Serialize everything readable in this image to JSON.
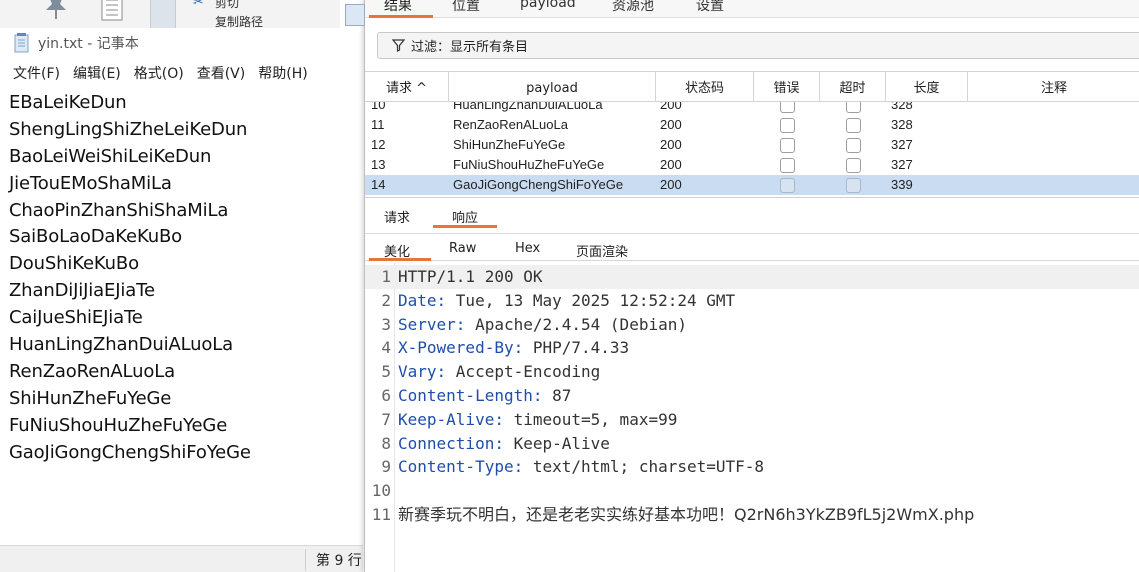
{
  "explorer": {
    "ribbon": [
      "剪切",
      "复制路径"
    ]
  },
  "notepad": {
    "title": "yin.txt - 记事本",
    "menu": [
      "文件(F)",
      "编辑(E)",
      "格式(O)",
      "查看(V)",
      "帮助(H)"
    ],
    "lines": [
      "EBaLeiKeDun",
      "ShengLingShiZheLeiKeDun",
      "BaoLeiWeiShiLeiKeDun",
      "JieTouEMoShaMiLa",
      "ChaoPinZhanShiShaMiLa",
      "SaiBoLaoDaKeKuBo",
      "DouShiKeKuBo",
      "ZhanDiJiJiaEJiaTe",
      "CaiJueShiEJiaTe",
      "HuanLingZhanDuiALuoLa",
      "RenZaoRenALuoLa",
      "ShiHunZheFuYeGe",
      "FuNiuShouHuZheFuYeGe",
      "GaoJiGongChengShiFoYeGe"
    ],
    "status": {
      "position": "第 9 行"
    },
    "edge_marks": [
      "权",
      "e"
    ]
  },
  "burp": {
    "top_tabs": [
      "结果",
      "位置",
      "payload",
      "资源池",
      "设置"
    ],
    "filter": {
      "text": "过滤：显示所有条目"
    },
    "columns": [
      "请求 ^",
      "payload",
      "状态码",
      "错误",
      "超时",
      "长度",
      "注释"
    ],
    "rows": [
      {
        "req": "10",
        "payload": "HuanLingZhanDuiALuoLa",
        "status": "200",
        "length": "328",
        "selected": false
      },
      {
        "req": "11",
        "payload": "RenZaoRenALuoLa",
        "status": "200",
        "length": "328",
        "selected": false
      },
      {
        "req": "12",
        "payload": "ShiHunZheFuYeGe",
        "status": "200",
        "length": "327",
        "selected": false
      },
      {
        "req": "13",
        "payload": "FuNiuShouHuZheFuYeGe",
        "status": "200",
        "length": "327",
        "selected": false
      },
      {
        "req": "14",
        "payload": "GaoJiGongChengShiFoYeGe",
        "status": "200",
        "length": "339",
        "selected": true
      }
    ],
    "req_resp_tabs": [
      "请求",
      "响应"
    ],
    "view_tabs": [
      "美化",
      "Raw",
      "Hex",
      "页面渲染"
    ],
    "response": {
      "status_line": "HTTP/1.1 200 OK",
      "headers": [
        {
          "name": "Date",
          "value": "Tue, 13 May 2025 12:52:24 GMT"
        },
        {
          "name": "Server",
          "value": "Apache/2.4.54 (Debian)"
        },
        {
          "name": "X-Powered-By",
          "value": "PHP/7.4.33"
        },
        {
          "name": "Vary",
          "value": "Accept-Encoding"
        },
        {
          "name": "Content-Length",
          "value": "87"
        },
        {
          "name": "Keep-Alive",
          "value": "timeout=5, max=99"
        },
        {
          "name": "Connection",
          "value": "Keep-Alive"
        },
        {
          "name": "Content-Type",
          "value": "text/html; charset=UTF-8"
        }
      ],
      "blank_line": "",
      "body": "新赛季玩不明白，还是老老实实练好基本功吧！Q2rN6h3YkZB9fL5j2WmX.php",
      "line_numbers": [
        "1",
        "2",
        "3",
        "4",
        "5",
        "6",
        "7",
        "8",
        "9",
        "10",
        "11"
      ]
    }
  },
  "colors": {
    "accent_orange": "#e8743b",
    "selected_row": "#c9dcf1",
    "header_key_blue": "#1f4ea8"
  }
}
